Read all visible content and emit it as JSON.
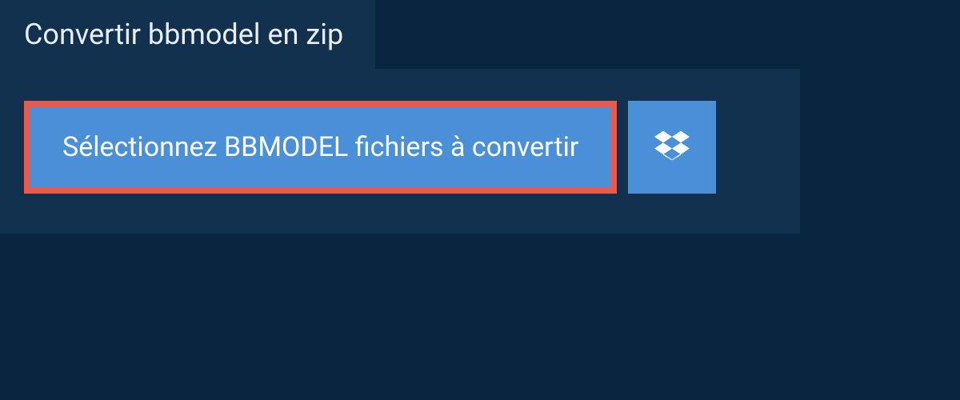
{
  "header": {
    "title": "Convertir bbmodel en zip"
  },
  "actions": {
    "select_files_label": "Sélectionnez BBMODEL fichiers à convertir"
  },
  "colors": {
    "background": "#0a2540",
    "panel": "#12314f",
    "button": "#4a90d9",
    "highlight_border": "#e65a4f",
    "text_light": "#e8eef3",
    "text_white": "#ffffff"
  }
}
